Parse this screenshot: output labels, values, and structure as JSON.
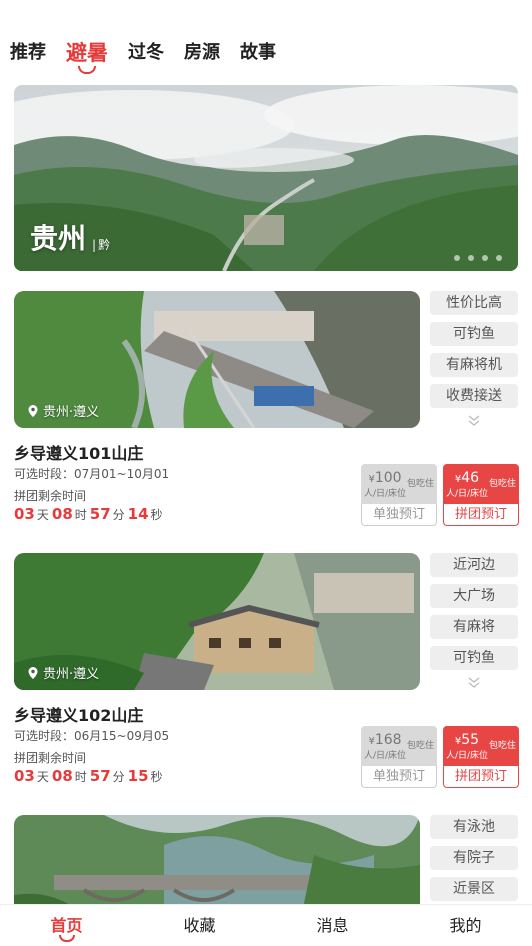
{
  "tabs": [
    {
      "label": "推荐",
      "active": false
    },
    {
      "label": "避暑",
      "active": true
    },
    {
      "label": "过冬",
      "active": false
    },
    {
      "label": "房源",
      "active": false
    },
    {
      "label": "故事",
      "active": false
    }
  ],
  "banner": {
    "title": "贵州",
    "subtitle": "黔",
    "slide_count": 4
  },
  "listings": [
    {
      "location": "贵州·遵义",
      "tags": [
        "性价比高",
        "可钓鱼",
        "有麻将机",
        "收费接送"
      ],
      "name": "乡导遵义101山庄",
      "period_label": "可选时段：",
      "period": "07月01~10月01",
      "remaining_label": "拼团剩余时间",
      "countdown": {
        "days": "03",
        "hours": "08",
        "minutes": "57",
        "seconds": "14",
        "day_unit": "天",
        "hour_unit": "时",
        "minute_unit": "分",
        "second_unit": "秒"
      },
      "solo": {
        "price": "100",
        "currency": "¥",
        "desc": "包吃住",
        "unit": "人/日/床位",
        "button": "单独预订"
      },
      "group": {
        "price": "46",
        "currency": "¥",
        "desc": "包吃住",
        "unit": "人/日/床位",
        "button": "拼团预订"
      }
    },
    {
      "location": "贵州·遵义",
      "tags": [
        "近河边",
        "大广场",
        "有麻将",
        "可钓鱼"
      ],
      "name": "乡导遵义102山庄",
      "period_label": "可选时段：",
      "period": "06月15~09月05",
      "remaining_label": "拼团剩余时间",
      "countdown": {
        "days": "03",
        "hours": "08",
        "minutes": "57",
        "seconds": "15",
        "day_unit": "天",
        "hour_unit": "时",
        "minute_unit": "分",
        "second_unit": "秒"
      },
      "solo": {
        "price": "168",
        "currency": "¥",
        "desc": "包吃住",
        "unit": "人/日/床位",
        "button": "单独预订"
      },
      "group": {
        "price": "55",
        "currency": "¥",
        "desc": "包吃住",
        "unit": "人/日/床位",
        "button": "拼团预订"
      }
    },
    {
      "tags": [
        "有泳池",
        "有院子",
        "近景区"
      ]
    }
  ],
  "bottom_nav": [
    {
      "label": "首页",
      "active": true
    },
    {
      "label": "收藏",
      "active": false
    },
    {
      "label": "消息",
      "active": false
    },
    {
      "label": "我的",
      "active": false
    }
  ],
  "colors": {
    "accent": "#e63b3b",
    "tag_bg": "#eeeeee",
    "solo_bg": "#d9d9d9"
  }
}
